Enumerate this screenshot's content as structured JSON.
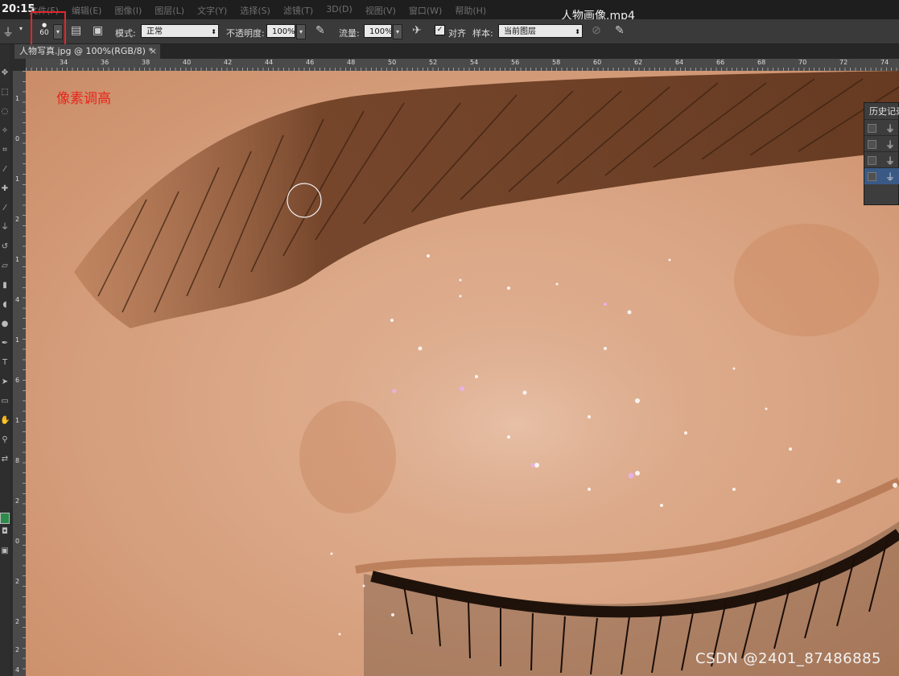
{
  "menubar": {
    "time": "20:15",
    "items": [
      "文件(F)",
      "编辑(E)",
      "图像(I)",
      "图层(L)",
      "文字(Y)",
      "选择(S)",
      "滤镜(T)",
      "3D(D)",
      "视图(V)",
      "窗口(W)",
      "帮助(H)"
    ],
    "video_title": "人物画像.mp4"
  },
  "options": {
    "brush_size": "60",
    "mode_label": "模式:",
    "mode_value": "正常",
    "opacity_label": "不透明度:",
    "opacity_value": "100%",
    "flow_label": "流量:",
    "flow_value": "100%",
    "aligned_label": "对齐",
    "aligned_checked": true,
    "sample_label": "样本:",
    "sample_value": "当前图层"
  },
  "document": {
    "tab_title": "人物写真.jpg @ 100%(RGB/8) *",
    "close_glyph": "×"
  },
  "ruler": {
    "top_ticks": [
      "34",
      "36",
      "38",
      "40",
      "42",
      "44",
      "46",
      "48",
      "50",
      "52",
      "54",
      "56",
      "58",
      "60",
      "62",
      "64",
      "66",
      "68",
      "70",
      "72",
      "74"
    ],
    "left_ticks": [
      "1",
      "0",
      "1",
      "2",
      "1",
      "4",
      "1",
      "6",
      "1",
      "8",
      "2",
      "0",
      "2",
      "2",
      "2",
      "4"
    ]
  },
  "canvas": {
    "annotation": "像素调高"
  },
  "history_panel": {
    "title": "历史记录",
    "rows": [
      {
        "icon": "stamp-icon",
        "active": false
      },
      {
        "icon": "stamp-icon",
        "active": false
      },
      {
        "icon": "stamp-icon",
        "active": false
      },
      {
        "icon": "stamp-icon",
        "active": true
      }
    ]
  },
  "watermark": "CSDN @2401_87486885",
  "colors": {
    "highlight_box": "#e3262a",
    "annotation_text": "#e8251c",
    "skin": "#d29a78",
    "brow": "#5a3119"
  }
}
